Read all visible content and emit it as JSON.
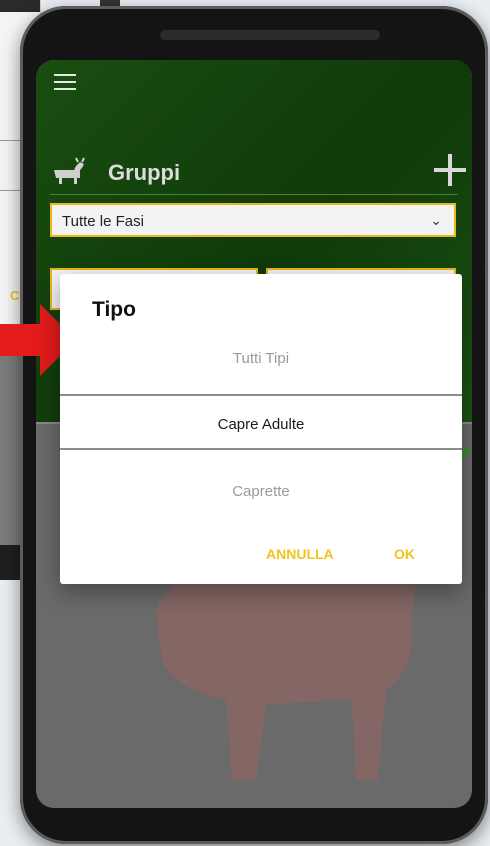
{
  "app": {
    "title": "Gruppi",
    "phase_filter": "Tutte le Fasi"
  },
  "dialog": {
    "title": "Tipo",
    "options": [
      {
        "label": "Tutti Tipi",
        "selected": false
      },
      {
        "label": "Capre Adulte",
        "selected": true
      },
      {
        "label": "Caprette",
        "selected": false
      }
    ],
    "cancel_label": "ANNULLA",
    "ok_label": "OK"
  },
  "background": {
    "partial_label": "C"
  },
  "colors": {
    "header_green": "#1a4e10",
    "accent_yellow": "#f0c419",
    "arrow_red": "#e31b1b"
  }
}
